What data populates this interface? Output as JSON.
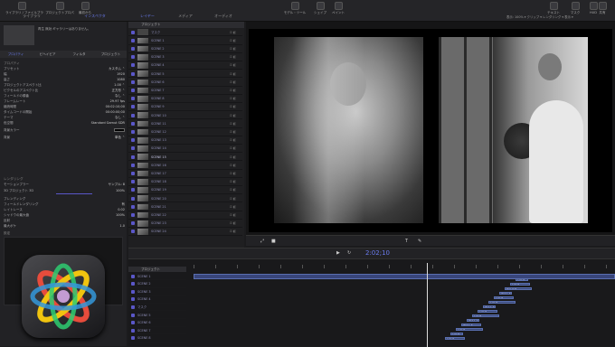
{
  "toolbar": {
    "buttons": [
      {
        "label": "ライブラリ / ファイルブラ"
      },
      {
        "label": "プロジェクトプロパ"
      },
      {
        "label": "最初から"
      },
      {
        "label": "モデル・ツール"
      },
      {
        "label": "シェイプ"
      },
      {
        "label": "ペイント"
      },
      {
        "label": "テンプレート"
      }
    ],
    "right_buttons": [
      {
        "label": "テキスト"
      },
      {
        "label": "マスク"
      },
      {
        "label": "HUD"
      },
      {
        "label": "共有"
      }
    ],
    "left_tabs": [
      "ライブラリ",
      "インスペクタ"
    ],
    "mid_tabs": [
      "レイヤー",
      "メディア",
      "オーディオ"
    ],
    "viewer_info": "表示: 100% ▾  クリップ ▾  レンダリング ▾  表示 ▾"
  },
  "inspector": {
    "preview_text": "再生 無効 ギャラリーはありません。",
    "tabs": [
      "プロパティ",
      "ビヘイビア",
      "フィルタ",
      "プロジェクト"
    ],
    "sections": [
      {
        "label": "プロパティ",
        "rows": []
      }
    ],
    "rows": [
      {
        "label": "プリセット",
        "value": "カスタム ⌃"
      },
      {
        "label": "幅",
        "value": "1920"
      },
      {
        "label": "高さ",
        "value": "1080"
      },
      {
        "label": "プロジェクトアスペクト比",
        "value": "1.00 ⌃"
      },
      {
        "label": "ピクセルのアスペクト比",
        "value": "正方形 ⌃"
      },
      {
        "label": "フィールドの順番",
        "value": "なし ⌃"
      },
      {
        "label": "フレームレート",
        "value": "29.97 fps"
      },
      {
        "label": "継続時間",
        "value": "00:02:10;00"
      },
      {
        "label": "タイムコードの開始",
        "value": "00:00:00;00"
      },
      {
        "label": "テーマ",
        "value": "なし ⌃"
      },
      {
        "label": "色空間",
        "value": "Standard Gamut SDR"
      },
      {
        "label": "背景カラー",
        "value": ""
      },
      {
        "label": "背景",
        "value": "単色 ⌃"
      }
    ],
    "render_section": "レンダリング",
    "render_rows": [
      {
        "label": "モーションブラー",
        "value": "サンプル: 8"
      },
      {
        "label": "3D プロジェクト 3D",
        "value": "100%"
      },
      {
        "label": "ブレンディング",
        "value": ""
      },
      {
        "label": "フィールドレンダリング",
        "value": "有"
      },
      {
        "label": "レイトレース",
        "value": "0.02"
      },
      {
        "label": "シャドウの最大値",
        "value": "100%"
      },
      {
        "label": "反射",
        "value": ""
      },
      {
        "label": "最大ボケ",
        "value": "1.0"
      }
    ],
    "footer": "設定"
  },
  "layers": {
    "header": "プロジェクト",
    "items": [
      "マスク",
      "SCENE 1",
      "SCENE 2",
      "SCENE 3",
      "SCENE 4",
      "SCENE 5",
      "SCENE 6",
      "SCENE 7",
      "SCENE 8",
      "SCENE 9",
      "SCENE 10",
      "SCENE 11",
      "SCENE 12",
      "SCENE 13",
      "SCENE 14",
      "SCENE 15",
      "SCENE 16",
      "SCENE 17",
      "SCENE 18",
      "SCENE 19",
      "SCENE 20",
      "SCENE 21",
      "SCENE 22",
      "SCENE 23",
      "SCENE 24"
    ]
  },
  "viewer": {
    "caption_left": "SCENE 1",
    "caption_right": "SCENE 2",
    "timecode": "2:02;10"
  },
  "timeline": {
    "header": "プロジェクト",
    "tracks": [
      "SCENE 1",
      "SCENE 2",
      "SCENE 3",
      "SCENE 4",
      "マスク",
      "SCENE 5",
      "SCENE 6",
      "SCENE 7",
      "SCENE 8"
    ],
    "clips": [
      "ソース",
      "ソース",
      "グループ",
      "タイトルレイヤー",
      "ソース",
      "ソース",
      "タイトルレイヤー",
      "ソース",
      "ソース",
      "タイトルレイヤー",
      "タイトル",
      "ソース",
      "ソース",
      "ソース"
    ]
  },
  "colors": {
    "accent": "#6b7cf0",
    "checkbox": "#5a57c8",
    "clip": "#3b4a78"
  },
  "app_icon": "motion-app-icon"
}
